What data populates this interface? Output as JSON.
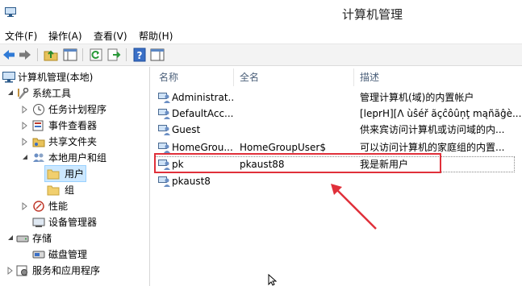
{
  "window": {
    "title": "计算机管理"
  },
  "menu": [
    "文件(F)",
    "操作(A)",
    "查看(V)",
    "帮助(H)"
  ],
  "toolbar": [
    "back-icon",
    "forward-icon",
    "up-folder-icon",
    "show-tree-icon",
    "refresh-icon",
    "export-icon",
    "help-icon",
    "properties-icon"
  ],
  "tree": {
    "root": "计算机管理(本地)",
    "system_tools": "系统工具",
    "task_scheduler": "任务计划程序",
    "event_viewer": "事件查看器",
    "shared_folders": "共享文件夹",
    "local_users_groups": "本地用户和组",
    "users": "用户",
    "groups": "组",
    "performance": "性能",
    "device_manager": "设备管理器",
    "storage": "存储",
    "disk_management": "磁盘管理",
    "services_apps": "服务和应用程序"
  },
  "columns": {
    "name": "名称",
    "fullname": "全名",
    "description": "描述"
  },
  "users": [
    {
      "name": "Administrat...",
      "fullname": "",
      "description": "管理计算机(域)的内置帐户"
    },
    {
      "name": "DefaultAcc...",
      "fullname": "",
      "description": "[leprH][Λ ùŝéř ãçĉôûņţ mąñãĝè..."
    },
    {
      "name": "Guest",
      "fullname": "",
      "description": "供来宾访问计算机或访问域的内..."
    },
    {
      "name": "HomeGrou...",
      "fullname": "HomeGroupUser$",
      "description": "可以访问计算机的家庭组的内置..."
    },
    {
      "name": "pk",
      "fullname": "pkaust88",
      "description": "我是新用户"
    },
    {
      "name": "pkaust8",
      "fullname": "",
      "description": ""
    }
  ],
  "colors": {
    "highlight": "#e0303a",
    "selection": "#cce8ff"
  }
}
